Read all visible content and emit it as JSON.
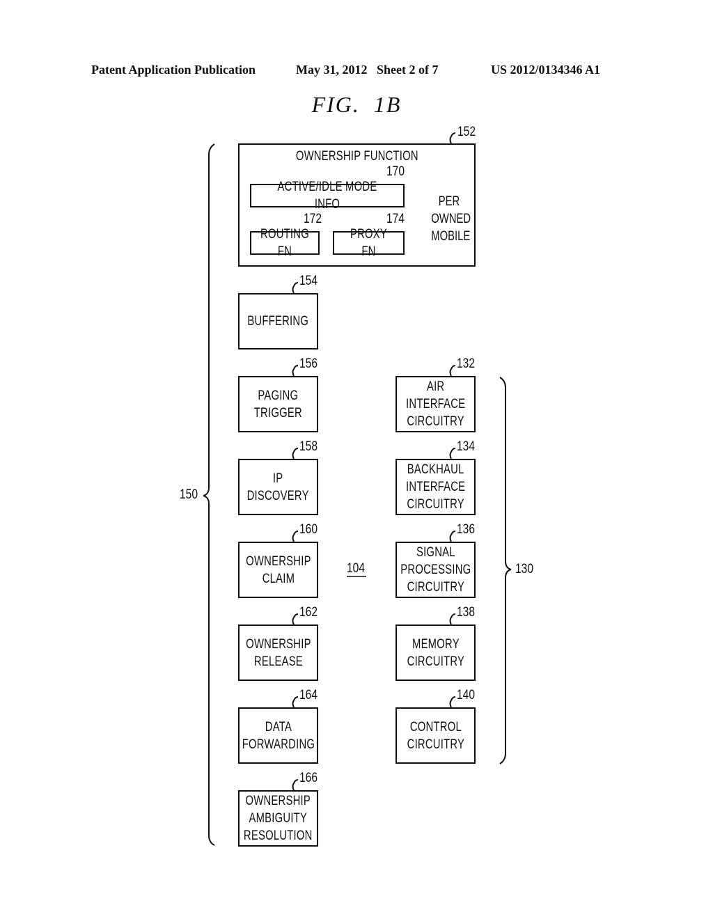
{
  "header": {
    "publication": "Patent Application Publication",
    "date_sheet": "May 31, 2012   Sheet 2 of 7",
    "patent_number": "US 2012/0134346 A1"
  },
  "figure": {
    "title": "FIG.  1B",
    "center_label": "104",
    "group_left": {
      "ref": "150"
    },
    "group_right": {
      "ref": "130"
    },
    "ownership_function": {
      "ref": "152",
      "title": "OWNERSHIP  FUNCTION",
      "per_owned_mobile": "PER\nOWNED\nMOBILE",
      "active_idle": {
        "ref": "170",
        "label": "ACTIVE/IDLE  MODE  INFO"
      },
      "routing": {
        "ref": "172",
        "label": "ROUTING  FN"
      },
      "proxy": {
        "ref": "174",
        "label": "PROXY  FN"
      }
    },
    "left_blocks": [
      {
        "ref": "154",
        "label": "BUFFERING"
      },
      {
        "ref": "156",
        "label": "PAGING\nTRIGGER"
      },
      {
        "ref": "158",
        "label": "IP\nDISCOVERY"
      },
      {
        "ref": "160",
        "label": "OWNERSHIP\nCLAIM"
      },
      {
        "ref": "162",
        "label": "OWNERSHIP\nRELEASE"
      },
      {
        "ref": "164",
        "label": "DATA\nFORWARDING"
      },
      {
        "ref": "166",
        "label": "OWNERSHIP\nAMBIGUITY\nRESOLUTION"
      }
    ],
    "right_blocks": [
      {
        "ref": "132",
        "label": "AIR\nINTERFACE\nCIRCUITRY"
      },
      {
        "ref": "134",
        "label": "BACKHAUL\nINTERFACE\nCIRCUITRY"
      },
      {
        "ref": "136",
        "label": "SIGNAL\nPROCESSING\nCIRCUITRY"
      },
      {
        "ref": "138",
        "label": "MEMORY\nCIRCUITRY"
      },
      {
        "ref": "140",
        "label": "CONTROL\nCIRCUITRY"
      }
    ]
  }
}
